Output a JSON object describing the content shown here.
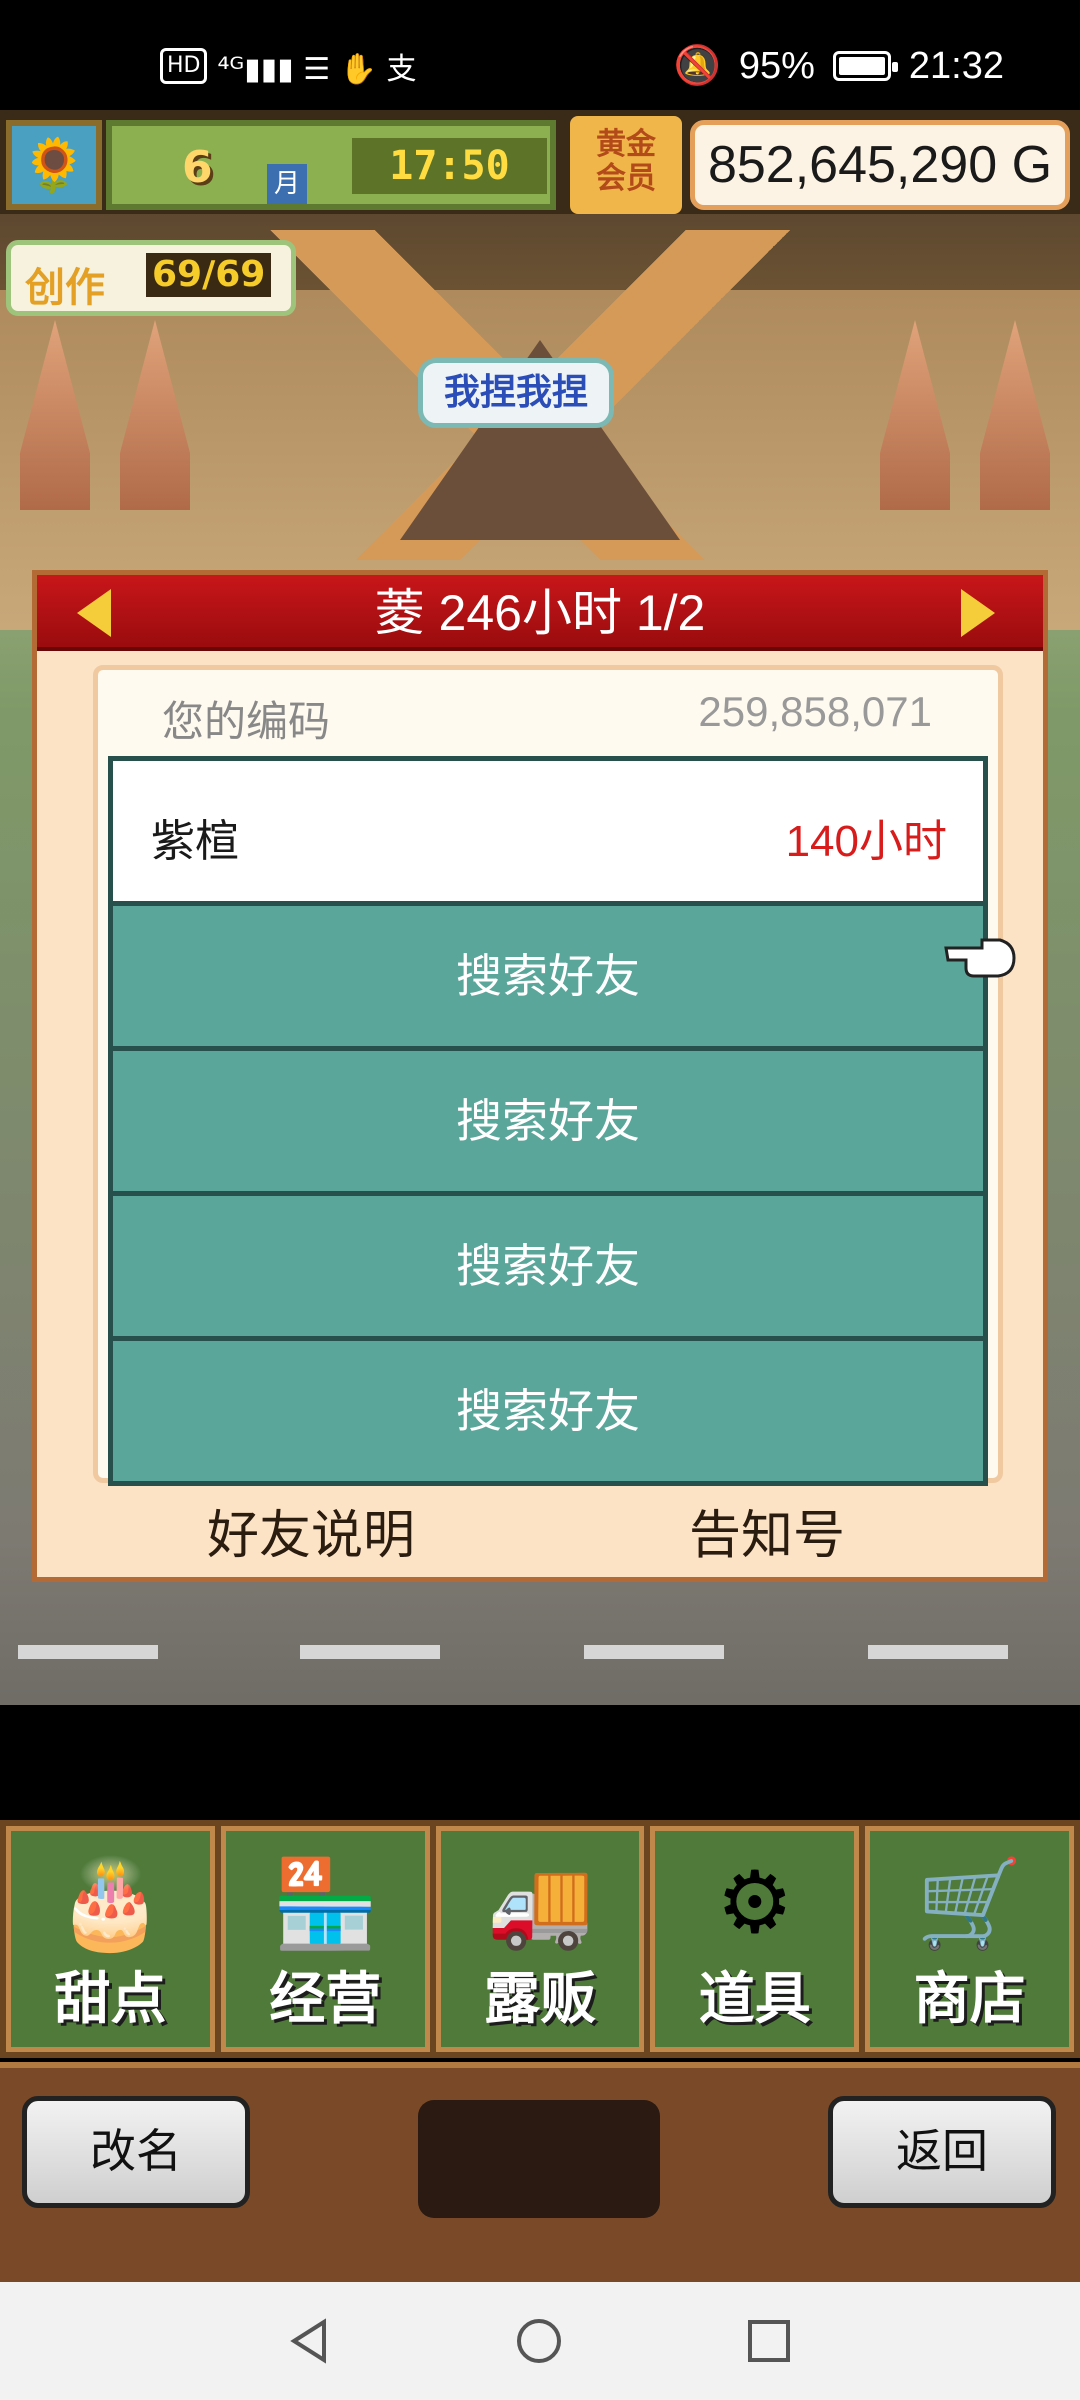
{
  "status_bar": {
    "left_chip": "HD",
    "left_icons": "⁴ᴳ▮▮▮ ☰ ✋ 支",
    "battery": "95%",
    "battery_level": 0.95,
    "time": "21:32"
  },
  "hud": {
    "month": "6",
    "month_word": "月",
    "time": "17:50",
    "gold_label_line1": "黄金",
    "gold_label_line2": "会员",
    "money": "852,645,290 G",
    "create_label": "创作",
    "create_value": "69/69",
    "tag": "我捏我捏"
  },
  "panel": {
    "title": "菱 246小时 1/2",
    "code_label": "您的编码",
    "code_value": "259,858,071",
    "friend": {
      "name": "紫楦",
      "hours": "140小时"
    },
    "search_rows": [
      "搜索好友",
      "搜索好友",
      "搜索好友",
      "搜索好友"
    ],
    "footer_left": "好友说明",
    "footer_right": "告知号"
  },
  "menu": [
    {
      "label": "甜点",
      "icon": "cake-icon"
    },
    {
      "label": "经营",
      "icon": "shop-icon"
    },
    {
      "label": "露贩",
      "icon": "food-truck-icon"
    },
    {
      "label": "道具",
      "icon": "items-icon"
    },
    {
      "label": "商店",
      "icon": "cart-icon"
    }
  ],
  "bottom": {
    "rename": "改名",
    "back": "返回"
  }
}
